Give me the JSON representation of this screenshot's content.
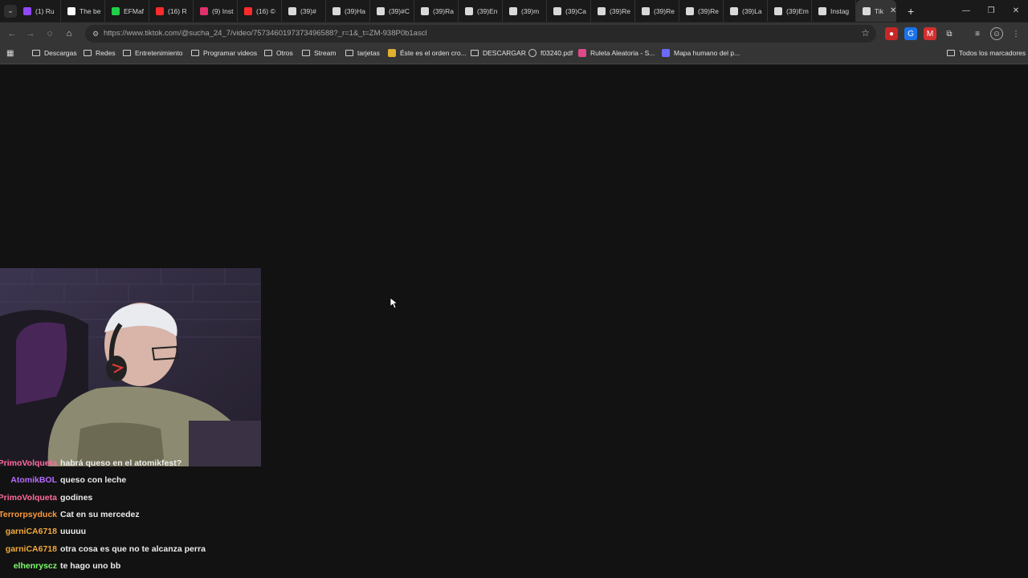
{
  "tabs": [
    {
      "title": "(1) Ru",
      "color": "#9147ff"
    },
    {
      "title": "The be",
      "color": "#ffffff"
    },
    {
      "title": "EFMaf",
      "color": "#21d04a"
    },
    {
      "title": "(16) R",
      "color": "#ff2b2b"
    },
    {
      "title": "(9) Inst",
      "color": "#e1306c"
    },
    {
      "title": "(16) ©",
      "color": "#ff2b2b"
    },
    {
      "title": "(39)#",
      "color": "#d9d9d9"
    },
    {
      "title": "(39)Ha",
      "color": "#d9d9d9"
    },
    {
      "title": "(39)#C",
      "color": "#d9d9d9"
    },
    {
      "title": "(39)Ra",
      "color": "#d9d9d9"
    },
    {
      "title": "(39)En",
      "color": "#d9d9d9"
    },
    {
      "title": "(39)m",
      "color": "#d9d9d9"
    },
    {
      "title": "(39)Ca",
      "color": "#d9d9d9"
    },
    {
      "title": "(39)Re",
      "color": "#d9d9d9"
    },
    {
      "title": "(39)Re",
      "color": "#d9d9d9"
    },
    {
      "title": "(39)Re",
      "color": "#d9d9d9"
    },
    {
      "title": "(39)La",
      "color": "#d9d9d9"
    },
    {
      "title": "(39)Em",
      "color": "#d9d9d9"
    },
    {
      "title": "Instag",
      "color": "#d9d9d9"
    },
    {
      "title": "Tik",
      "color": "#d9d9d9"
    }
  ],
  "address_bar": {
    "url": "https://www.tiktok.com/@sucha_24_7/video/7573460197373496588?_r=1&_t=ZM-938P0b1ascl"
  },
  "bookmarks": [
    {
      "label": "Descargas",
      "icon": "folder-icon"
    },
    {
      "label": "Redes",
      "icon": "folder-icon"
    },
    {
      "label": "Entretenimiento",
      "icon": "folder-icon"
    },
    {
      "label": "Programar videos",
      "icon": "folder-icon"
    },
    {
      "label": "Otros",
      "icon": "folder-icon"
    },
    {
      "label": "Stream",
      "icon": "folder-icon"
    },
    {
      "label": "tarjetas",
      "icon": "folder-icon"
    },
    {
      "label": "Éste es el orden cro...",
      "icon": "bookmark-favicon"
    },
    {
      "label": "DESCARGAR",
      "icon": "folder-icon"
    },
    {
      "label": "f03240.pdf",
      "icon": "globe-icon"
    },
    {
      "label": "Ruleta Aleatoria - S...",
      "icon": "bookmark-favicon"
    },
    {
      "label": "Mapa humano del p...",
      "icon": "bookmark-favicon"
    },
    {
      "label": "Todos los marcadores",
      "icon": "folder-icon"
    }
  ],
  "chat": [
    {
      "user": "PrimoVolqueta",
      "message": "habrá queso en el atomikfest?",
      "color": "#ff6b9d"
    },
    {
      "user": "AtomikBOL",
      "message": "queso con leche",
      "color": "#b56cff"
    },
    {
      "user": "PrimoVolqueta",
      "message": "godines",
      "color": "#ff6b9d"
    },
    {
      "user": "Terrorpsyduck",
      "message": "Cat en su mercedez",
      "color": "#ff9a3c"
    },
    {
      "user": "garniCA6718",
      "message": "uuuuu",
      "color": "#f2a93b"
    },
    {
      "user": "garniCA6718",
      "message": "otra cosa es que no te alcanza perra",
      "color": "#f2a93b"
    },
    {
      "user": "elhenryscz",
      "message": "te hago uno bb",
      "color": "#7cff6b"
    }
  ]
}
